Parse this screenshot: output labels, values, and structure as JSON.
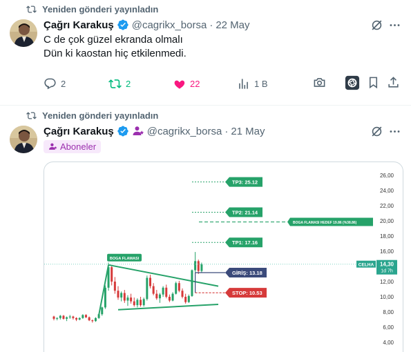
{
  "tweets": [
    {
      "repost_label": "Yeniden gönderi yayınladın",
      "author_name": "Çağrı Karakuş",
      "author_handle": "@cagrikx_borsa",
      "dot": "·",
      "date": "22 May",
      "text_line1": "C de çok güzel ekranda olmalı",
      "text_line2": "Dün ki kaostan hiç etkilenmedi.",
      "reply_count": "2",
      "repost_count": "2",
      "like_count": "22",
      "view_count": "1 B"
    },
    {
      "repost_label": "Yeniden gönderi yayınladın",
      "author_name": "Çağrı Karakuş",
      "author_handle": "@cagrikx_borsa",
      "dot": "·",
      "date": "21 May",
      "subscriber_badge": "Aboneler"
    }
  ],
  "colors": {
    "muted": "#536471",
    "repost_green": "#00ba7c",
    "like_pink": "#f91880",
    "verified_blue": "#1d9bf0",
    "subscriber_purple": "#9b2fae",
    "chart_green": "#26a269",
    "chart_red": "#d63a3a",
    "entry_navy": "#3b4a7a"
  },
  "chart": {
    "y_ticks": [
      "26,00",
      "24,00",
      "22,00",
      "20,00",
      "18,00",
      "16,00",
      "14,00",
      "12,00",
      "10,00",
      "8,00",
      "6,00",
      "4,00"
    ],
    "labels": {
      "tp3": "TP3: 25.12",
      "tp2": "TP2: 21.14",
      "tp1": "TP1: 17.16",
      "target": "BOGA FLAMASI HEDEF 19.86 (%38.86)",
      "pattern": "BOGA FLAMASI",
      "entry": "GİRİŞ: 13.18",
      "stop": "STOP: 10.53",
      "ticker": "CELHA",
      "price": "14,30",
      "timeframe": "1d 7h"
    }
  },
  "chart_data": {
    "type": "candlestick",
    "ticker": "CELHA",
    "ylim": [
      4,
      26
    ],
    "y_ticks": [
      26,
      24,
      22,
      20,
      18,
      16,
      14,
      12,
      10,
      8,
      6,
      4
    ],
    "last_price": 14.3,
    "levels": {
      "tp3": 25.12,
      "tp2": 21.14,
      "tp1": 17.16,
      "target": 19.86,
      "entry": 13.18,
      "stop": 10.53
    },
    "candles": [
      [
        7.4,
        7.5,
        6.9,
        7.1
      ],
      [
        7.1,
        7.3,
        6.9,
        7.2
      ],
      [
        7.2,
        7.6,
        7.0,
        7.5
      ],
      [
        7.5,
        7.6,
        7.0,
        7.1
      ],
      [
        7.1,
        7.4,
        6.8,
        7.3
      ],
      [
        7.3,
        7.6,
        7.1,
        7.4
      ],
      [
        7.4,
        7.5,
        7.0,
        7.2
      ],
      [
        7.2,
        7.3,
        6.8,
        7.0
      ],
      [
        7.0,
        7.3,
        6.9,
        7.2
      ],
      [
        7.2,
        7.7,
        7.1,
        7.6
      ],
      [
        7.6,
        7.7,
        7.2,
        7.3
      ],
      [
        7.3,
        7.4,
        6.8,
        6.9
      ],
      [
        6.9,
        7.0,
        6.6,
        6.8
      ],
      [
        6.8,
        7.3,
        6.7,
        7.2
      ],
      [
        7.2,
        7.8,
        7.1,
        7.7
      ],
      [
        7.7,
        8.7,
        7.5,
        8.6
      ],
      [
        8.6,
        11.5,
        8.4,
        11.2
      ],
      [
        11.2,
        14.5,
        10.8,
        13.9
      ],
      [
        13.9,
        14.1,
        11.5,
        12.0
      ],
      [
        12.0,
        12.6,
        10.4,
        10.8
      ],
      [
        10.8,
        11.4,
        9.6,
        9.9
      ],
      [
        9.9,
        10.7,
        9.4,
        10.5
      ],
      [
        10.5,
        10.9,
        9.2,
        9.5
      ],
      [
        9.5,
        10.2,
        8.8,
        9.9
      ],
      [
        9.9,
        10.4,
        9.1,
        9.4
      ],
      [
        9.4,
        9.9,
        8.7,
        8.9
      ],
      [
        8.9,
        9.8,
        8.6,
        9.6
      ],
      [
        9.6,
        10.0,
        8.7,
        8.9
      ],
      [
        8.9,
        9.9,
        8.7,
        9.7
      ],
      [
        9.7,
        12.8,
        9.5,
        12.5
      ],
      [
        12.5,
        12.9,
        11.1,
        11.4
      ],
      [
        11.4,
        11.8,
        10.2,
        10.4
      ],
      [
        10.4,
        10.9,
        9.6,
        9.8
      ],
      [
        9.8,
        10.5,
        9.2,
        10.3
      ],
      [
        10.3,
        11.4,
        10.0,
        11.2
      ],
      [
        11.2,
        11.6,
        9.8,
        10.0
      ],
      [
        10.0,
        10.3,
        9.3,
        9.5
      ],
      [
        9.5,
        10.6,
        9.4,
        10.4
      ],
      [
        10.4,
        12.0,
        10.3,
        11.8
      ],
      [
        11.8,
        12.1,
        10.6,
        10.8
      ],
      [
        10.8,
        11.1,
        9.8,
        10.0
      ],
      [
        10.0,
        10.4,
        9.1,
        9.3
      ],
      [
        9.3,
        10.3,
        9.2,
        10.1
      ],
      [
        10.1,
        13.6,
        10.0,
        13.5
      ],
      [
        13.5,
        15.9,
        13.2,
        14.7
      ],
      [
        14.7,
        14.9,
        13.0,
        13.4
      ],
      [
        13.4,
        14.5,
        13.2,
        14.3
      ]
    ]
  }
}
